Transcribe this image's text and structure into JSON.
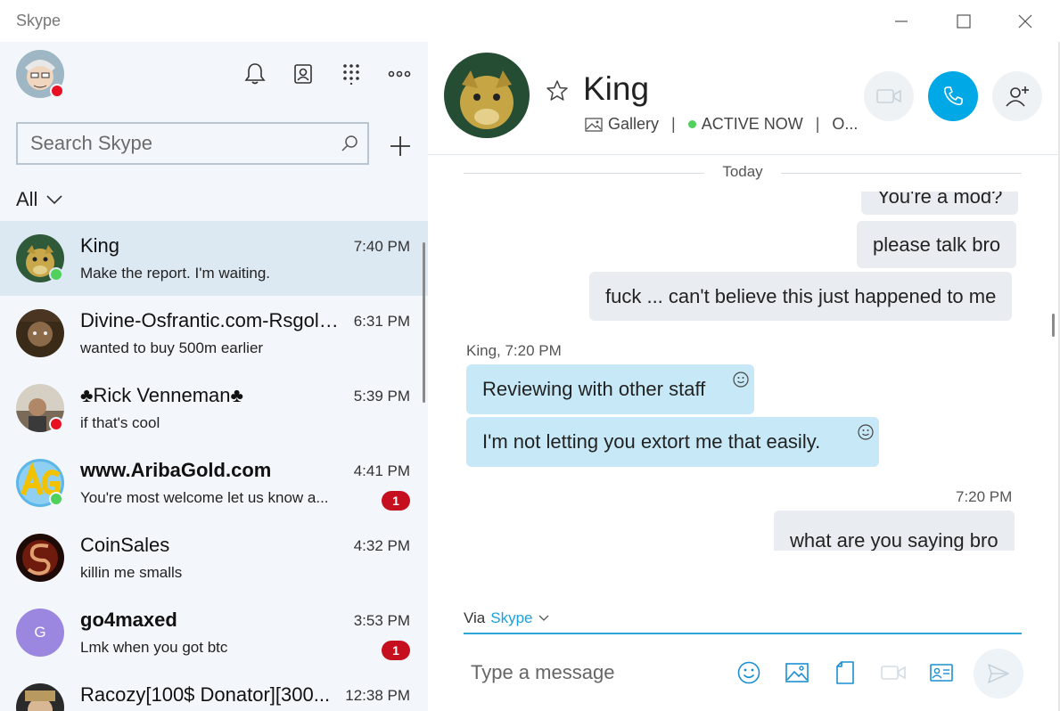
{
  "window": {
    "title": "Skype"
  },
  "sidebar": {
    "search_placeholder": "Search Skype",
    "filter_label": "All",
    "conversations": [
      {
        "name": "King",
        "time": "7:40 PM",
        "preview": "Make the report. I'm waiting.",
        "bold": false,
        "status": "online",
        "badge": ""
      },
      {
        "name": "Divine-Osfrantic.com-Rsgold...",
        "time": "6:31 PM",
        "preview": "wanted to buy 500m earlier",
        "bold": false,
        "status": "",
        "badge": ""
      },
      {
        "name": "♣Rick Venneman♣",
        "time": "5:39 PM",
        "preview": "if that's cool",
        "bold": false,
        "status": "busy",
        "badge": ""
      },
      {
        "name": "www.AribaGold.com",
        "time": "4:41 PM",
        "preview": "You're most welcome let us know a...",
        "bold": true,
        "status": "online",
        "badge": "1"
      },
      {
        "name": "CoinSales",
        "time": "4:32 PM",
        "preview": "killin me smalls",
        "bold": false,
        "status": "",
        "badge": ""
      },
      {
        "name": "go4maxed",
        "time": "3:53 PM",
        "preview": "Lmk when you got btc",
        "bold": true,
        "status": "",
        "badge": "1",
        "initial": "G"
      },
      {
        "name": "Racozy[100$ Donator][300...",
        "time": "12:38 PM",
        "preview": "",
        "bold": false,
        "status": "",
        "badge": ""
      }
    ]
  },
  "chat": {
    "name": "King",
    "gallery_label": "Gallery",
    "status_label": "ACTIVE NOW",
    "extra_label": "O...",
    "separator": "|",
    "day_label": "Today",
    "messages": {
      "out_partial": "You're a mod?",
      "out_1": "please talk bro",
      "out_2": "fuck ... can't believe this just happened to me",
      "in_meta": "King, 7:20 PM",
      "in_1": "Reviewing with other staff",
      "in_2": "I'm not letting you extort me that easily.",
      "out_meta": "7:20 PM",
      "out_3": "what are you saying bro"
    },
    "via_label": "Via",
    "via_link": "Skype",
    "composer_placeholder": "Type a message"
  },
  "colors": {
    "accent": "#00a8e6",
    "online": "#4fd15b",
    "busy": "#e81123",
    "badge": "#c50f1f",
    "incoming_bubble": "#c7e9f7",
    "outgoing_bubble": "#e9edf1"
  }
}
